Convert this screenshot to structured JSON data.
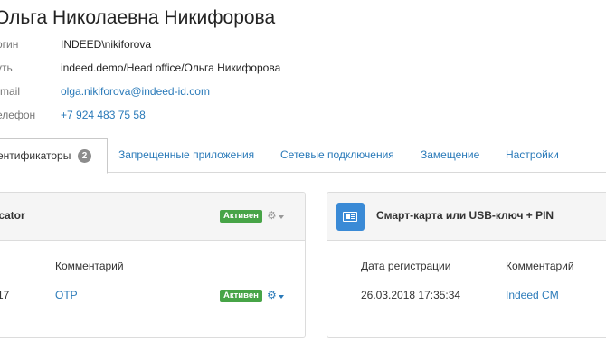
{
  "user": {
    "full_name": "Ольга Николаевна Никифорова",
    "fields": [
      {
        "label": "огин",
        "value": "INDEED\\nikiforova",
        "is_link": false
      },
      {
        "label": "уть",
        "value": "indeed.demo/Head office/Ольга Никифорова",
        "is_link": false
      },
      {
        "label": "-mail",
        "value": "olga.nikiforova@indeed-id.com",
        "is_link": true
      },
      {
        "label": "елефон",
        "value": "+7 924 483 75 58",
        "is_link": true
      }
    ]
  },
  "tabs": {
    "authenticators": {
      "label": "ентификаторы",
      "count": "2"
    },
    "blocked_apps": "Запрещенные приложения",
    "network": "Сетевые подключения",
    "substitution": "Замещение",
    "settings": "Настройки"
  },
  "left_card": {
    "title": "ticator",
    "status": "Активен",
    "col_comment": "Комментарий",
    "row": {
      "date": "17",
      "comment": "OTP",
      "status": "Активен"
    }
  },
  "right_card": {
    "title": "Смарт-карта или USB-ключ + PIN",
    "icon": "smart-card-icon",
    "col_date": "Дата регистрации",
    "col_comment": "Комментарий",
    "row": {
      "date": "26.03.2018 17:35:34",
      "comment": "Indeed CM"
    }
  },
  "colors": {
    "link": "#2a7ab9",
    "active_badge": "#47a447",
    "icon_bg": "#3a8ad6",
    "count_badge": "#8c8c8c"
  }
}
